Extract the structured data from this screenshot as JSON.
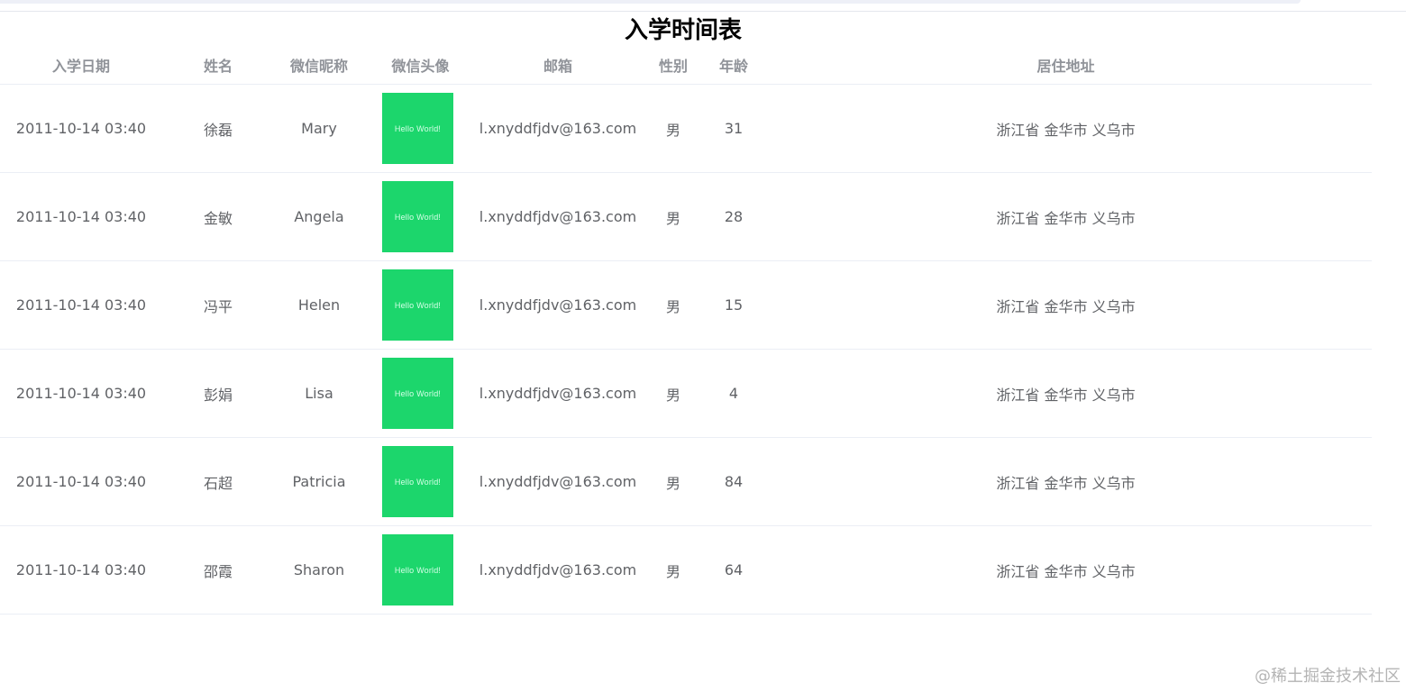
{
  "title": "入学时间表",
  "columns": {
    "date": "入学日期",
    "name": "姓名",
    "nickname": "微信昵称",
    "avatar": "微信头像",
    "email": "邮箱",
    "gender": "性别",
    "age": "年龄",
    "address": "居住地址"
  },
  "rows": [
    {
      "date": "2011-10-14 03:40",
      "name": "徐磊",
      "nickname": "Mary",
      "avatar_text": "Hello World!",
      "email": "l.xnyddfjdv@163.com",
      "gender": "男",
      "age": "31",
      "address": "浙江省 金华市 义乌市"
    },
    {
      "date": "2011-10-14 03:40",
      "name": "金敏",
      "nickname": "Angela",
      "avatar_text": "Hello World!",
      "email": "l.xnyddfjdv@163.com",
      "gender": "男",
      "age": "28",
      "address": "浙江省 金华市 义乌市"
    },
    {
      "date": "2011-10-14 03:40",
      "name": "冯平",
      "nickname": "Helen",
      "avatar_text": "Hello World!",
      "email": "l.xnyddfjdv@163.com",
      "gender": "男",
      "age": "15",
      "address": "浙江省 金华市 义乌市"
    },
    {
      "date": "2011-10-14 03:40",
      "name": "彭娟",
      "nickname": "Lisa",
      "avatar_text": "Hello World!",
      "email": "l.xnyddfjdv@163.com",
      "gender": "男",
      "age": "4",
      "address": "浙江省 金华市 义乌市"
    },
    {
      "date": "2011-10-14 03:40",
      "name": "石超",
      "nickname": "Patricia",
      "avatar_text": "Hello World!",
      "email": "l.xnyddfjdv@163.com",
      "gender": "男",
      "age": "84",
      "address": "浙江省 金华市 义乌市"
    },
    {
      "date": "2011-10-14 03:40",
      "name": "邵霞",
      "nickname": "Sharon",
      "avatar_text": "Hello World!",
      "email": "l.xnyddfjdv@163.com",
      "gender": "男",
      "age": "64",
      "address": "浙江省 金华市 义乌市"
    }
  ],
  "colors": {
    "avatar_bg": "#1cd66c",
    "header_text": "#909399",
    "cell_text": "#606266",
    "row_border": "#ebeef5"
  },
  "watermark": "@稀土掘金技术社区"
}
